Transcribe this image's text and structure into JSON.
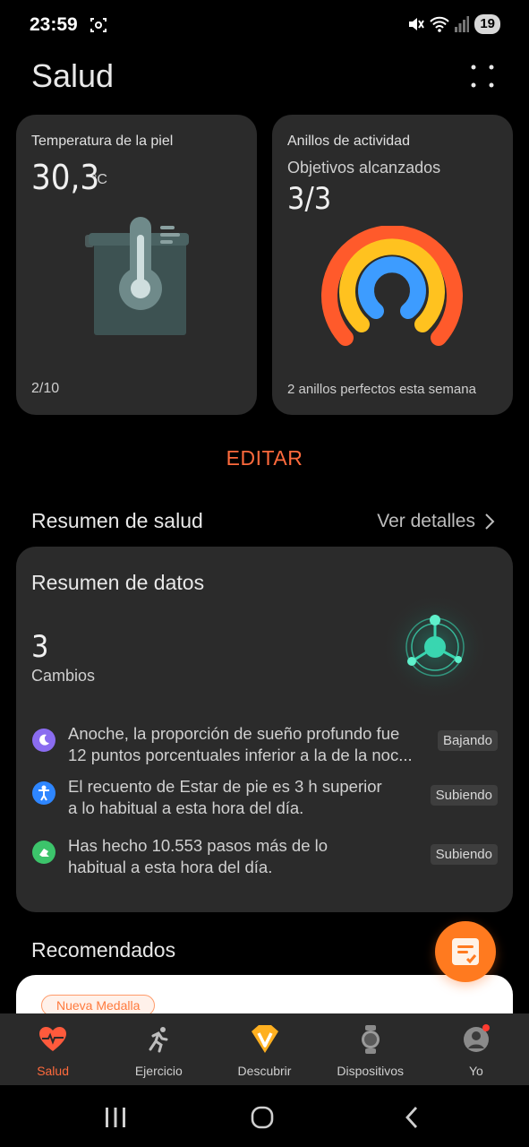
{
  "status_bar": {
    "time": "23:59",
    "battery": "19"
  },
  "header": {
    "title": "Salud"
  },
  "skin_temperature_card": {
    "title": "Temperatura de la piel",
    "value": "30,3",
    "unit": "°C",
    "footer": "2/10"
  },
  "activity_rings_card": {
    "title": "Anillos de actividad",
    "subtitle": "Objetivos alcanzados",
    "count": "3/3",
    "footer": "2 anillos perfectos esta semana",
    "ring_colors": [
      "#ff5a2b",
      "#ffc21f",
      "#3d9cff"
    ]
  },
  "edit_button": "EDITAR",
  "health_summary": {
    "section_title": "Resumen de salud",
    "details_link": "Ver detalles",
    "card_title": "Resumen de datos",
    "changes_count": "3",
    "changes_label": "Cambios",
    "insights": [
      {
        "icon": "moon-icon",
        "color": "#8a6cf0",
        "line1": "Anoche, la proporción de sueño profundo fue",
        "line2": "12 puntos porcentuales inferior a la de la noc...",
        "trend": "Bajando"
      },
      {
        "icon": "person-standing-icon",
        "color": "#2e86ff",
        "line1": "El recuento de Estar de pie es 3 h superior",
        "line2": "a lo habitual a esta hora del día.",
        "trend": "Subiendo"
      },
      {
        "icon": "steps-icon",
        "color": "#3cc46b",
        "line1": "Has hecho 10.553 pasos más de lo",
        "line2": "habitual a esta hora del día.",
        "trend": "Subiendo"
      }
    ]
  },
  "recommended": {
    "section_title": "Recomendados",
    "badge": "Nueva Medalla"
  },
  "bottom_nav": {
    "items": [
      {
        "label": "Salud",
        "icon": "heart-icon"
      },
      {
        "label": "Ejercicio",
        "icon": "running-icon"
      },
      {
        "label": "Descubrir",
        "icon": "discover-icon"
      },
      {
        "label": "Dispositivos",
        "icon": "watch-icon"
      },
      {
        "label": "Yo",
        "icon": "profile-icon"
      }
    ]
  },
  "accent_color": "#ff6a3c"
}
